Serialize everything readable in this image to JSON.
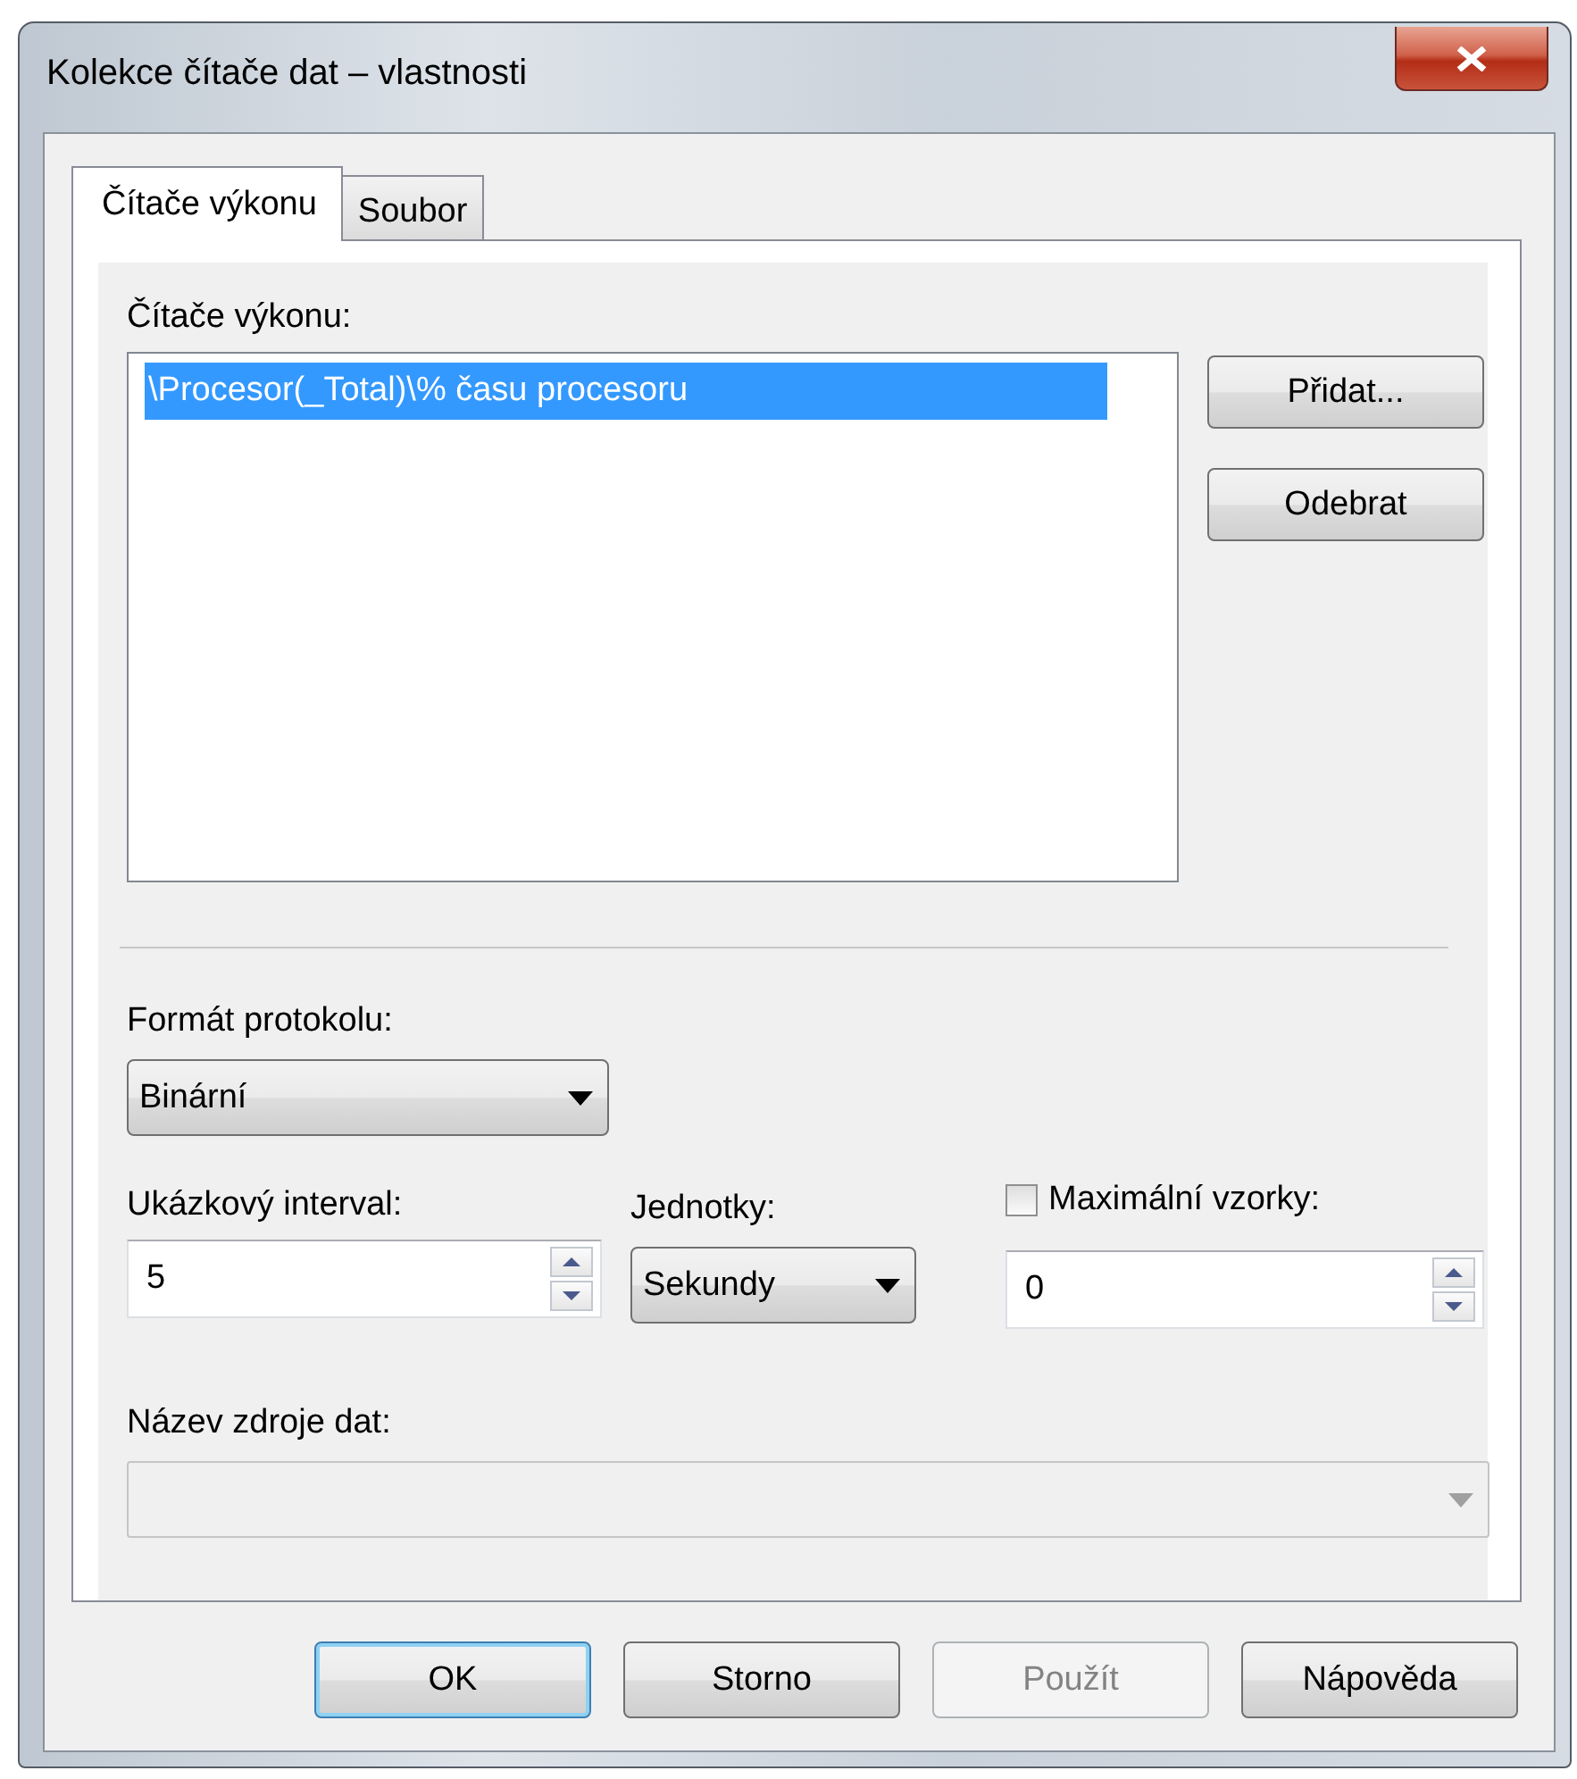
{
  "window": {
    "title": "Kolekce čítače dat – vlastnosti"
  },
  "tabs": [
    {
      "label": "Čítače výkonu",
      "selected": true
    },
    {
      "label": "Soubor",
      "selected": false
    }
  ],
  "counters": {
    "label": "Čítače výkonu:",
    "items": [
      {
        "text": "\\Procesor(_Total)\\% času procesoru",
        "selected": true
      }
    ],
    "buttons": [
      "Přidat...",
      "Odebrat"
    ]
  },
  "log_format": {
    "label": "Formát protokolu:",
    "value": "Binární"
  },
  "sample_interval": {
    "label": "Ukázkový interval:",
    "value": "5"
  },
  "units": {
    "label": "Jednotky:",
    "value": "Sekundy"
  },
  "max_samples": {
    "label": "Maximální vzorky:",
    "checked": false,
    "value": "0"
  },
  "data_source": {
    "label": "Název zdroje dat:",
    "disabled": true
  },
  "buttons": [
    {
      "label": "OK",
      "default": true,
      "disabled": false
    },
    {
      "label": "Storno",
      "default": false,
      "disabled": false
    },
    {
      "label": "Použít",
      "default": false,
      "disabled": true
    },
    {
      "label": "Nápověda",
      "default": false,
      "disabled": false
    }
  ]
}
